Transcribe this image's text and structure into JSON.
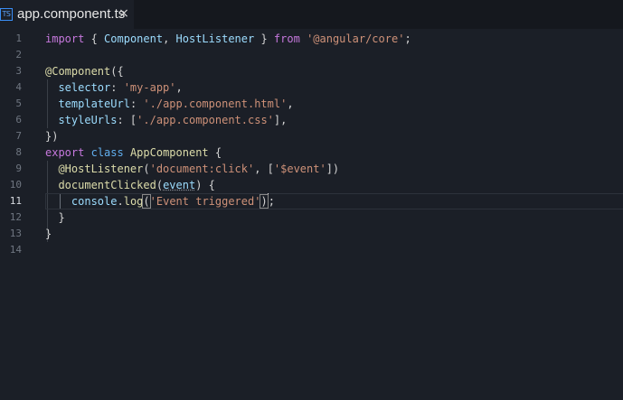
{
  "tab": {
    "icon": "TS",
    "title": "app.component.ts",
    "close": "×"
  },
  "line_numbers": [
    "1",
    "2",
    "3",
    "4",
    "5",
    "6",
    "7",
    "8",
    "9",
    "10",
    "11",
    "12",
    "13",
    "14"
  ],
  "active_line": 11,
  "code": {
    "l1": {
      "kw_import": "import",
      "brace_open": " { ",
      "comp": "Component",
      "comma": ", ",
      "host": "HostListener",
      "brace_close": " } ",
      "kw_from": "from",
      "sp": " ",
      "module": "'@angular/core'",
      "semi": ";"
    },
    "l3": {
      "at": "@Component",
      "rest": "({"
    },
    "l4": {
      "indent": "  ",
      "key": "selector",
      "colon": ": ",
      "val": "'my-app'",
      "comma": ","
    },
    "l5": {
      "indent": "  ",
      "key": "templateUrl",
      "colon": ": ",
      "val": "'./app.component.html'",
      "comma": ","
    },
    "l6": {
      "indent": "  ",
      "key": "styleUrls",
      "colon": ": [",
      "val": "'./app.component.css'",
      "close": "],",
      "end": ""
    },
    "l7": {
      "text": "})"
    },
    "l8": {
      "kw_export": "export",
      "sp1": " ",
      "kw_class": "class",
      "sp2": " ",
      "name": "AppComponent",
      "rest": " {"
    },
    "l9": {
      "indent": "  ",
      "dec": "@HostListener",
      "p1": "(",
      "s1": "'document:click'",
      "p2": ", [",
      "s2": "'$event'",
      "p3": "])"
    },
    "l10": {
      "indent": "  ",
      "fn": "documentClicked",
      "p1": "(",
      "param": "event",
      "p2": ") {"
    },
    "l11": {
      "indent": "    ",
      "obj": "console",
      "dot": ".",
      "fn": "log",
      "p1": "(",
      "s1": "'Event triggered'",
      "p2": ")",
      "semi": ";"
    },
    "l12": {
      "text": "  }"
    },
    "l13": {
      "text": "}"
    }
  },
  "colors": {
    "background": "#1b1f27",
    "keyword": "#c678dd",
    "entity": "#61afef",
    "string": "#ce9178",
    "function": "#dcdcaa",
    "property": "#9cdcfe"
  }
}
